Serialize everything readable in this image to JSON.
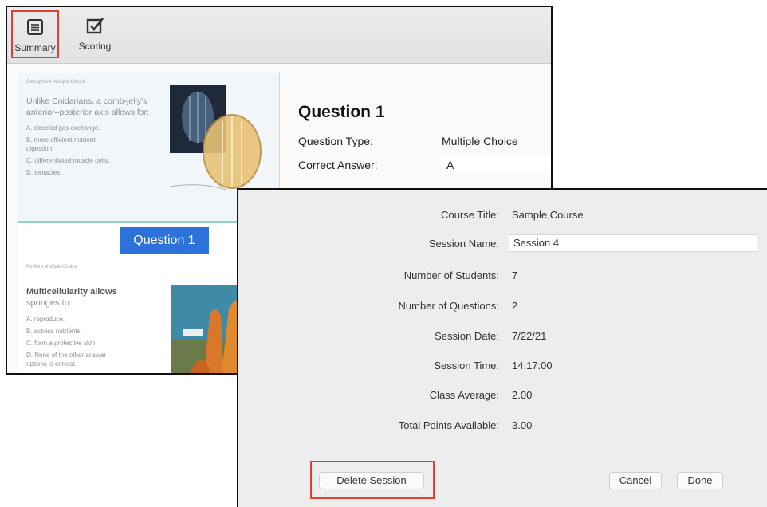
{
  "toolbar": {
    "summary_label": "Summary",
    "scoring_label": "Scoring",
    "summary_icon": "list-icon",
    "scoring_icon": "checkbox-icon",
    "highlight_color": "#e0402f"
  },
  "slides": {
    "slide1": {
      "tiny_header": "Ctenophora Multiple Choice",
      "question_line1": "Unlike Cnidarians, a comb-jelly's",
      "question_line2": "anterior–posterior axis allows for:",
      "options": [
        "A.  directed gas exchange.",
        "B.  more efficient nutrient",
        "     digestion.",
        "C.  differentiated muscle cells.",
        "D.  tentacles."
      ]
    },
    "banner": "Question 1",
    "slide2": {
      "tiny_header": "Porifera Multiple Choice",
      "question_line1": "Multicellularity allows",
      "question_line2": "sponges to:",
      "options": [
        "A.  reproduce.",
        "B.  access nutrients.",
        "C.  form a protective skin.",
        "D.  None of the other answer",
        "     options is correct."
      ]
    }
  },
  "question_panel": {
    "title": "Question 1",
    "type_label": "Question Type:",
    "type_value": "Multiple Choice",
    "answer_label": "Correct Answer:",
    "answer_value": "A"
  },
  "session_dialog": {
    "rows": [
      {
        "label": "Course Title:",
        "value": "Sample Course"
      },
      {
        "label": "Session Name:",
        "value": "Session 4"
      },
      {
        "label": "Number of Students:",
        "value": "7"
      },
      {
        "label": "Number of Questions:",
        "value": "2"
      },
      {
        "label": "Session Date:",
        "value": "7/22/21"
      },
      {
        "label": "Session Time:",
        "value": "14:17:00"
      },
      {
        "label": "Class Average:",
        "value": "2.00"
      },
      {
        "label": "Total Points Available:",
        "value": "3.00"
      }
    ],
    "delete_label": "Delete Session",
    "cancel_label": "Cancel",
    "done_label": "Done"
  }
}
